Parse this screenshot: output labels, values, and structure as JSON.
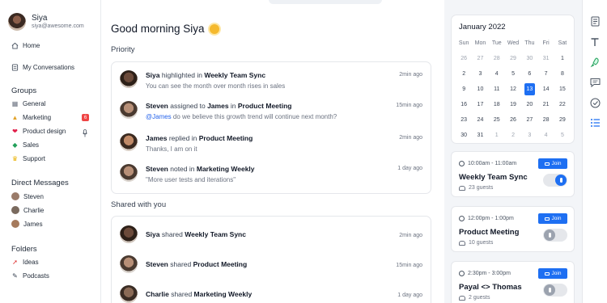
{
  "profile": {
    "name": "Siya",
    "email": "siya@awesome.com"
  },
  "nav": [
    {
      "label": "Home",
      "icon": "home-icon"
    },
    {
      "label": "My Conversations",
      "icon": "conversations-icon"
    }
  ],
  "groups": {
    "heading": "Groups",
    "items": [
      {
        "label": "General",
        "icon": "building-emoji"
      },
      {
        "label": "Marketing",
        "icon": "megaphone-emoji",
        "badge": "6"
      },
      {
        "label": "Product design",
        "icon": "heart-emoji"
      },
      {
        "label": "Sales",
        "icon": "money-emoji"
      },
      {
        "label": "Support",
        "icon": "crown-emoji"
      }
    ]
  },
  "direct_messages": {
    "heading": "Direct Messages",
    "items": [
      {
        "label": "Steven"
      },
      {
        "label": "Charlie"
      },
      {
        "label": "James"
      }
    ]
  },
  "folders": {
    "heading": "Folders",
    "items": [
      {
        "label": "Ideas",
        "icon": "rocket-emoji"
      },
      {
        "label": "Podcasts",
        "icon": "pen-emoji"
      }
    ]
  },
  "main": {
    "greeting": "Good morning Siya",
    "priority_heading": "Priority",
    "priority": [
      {
        "who": "Siya",
        "verb": " highlighted in ",
        "where": "Weekly Team Sync",
        "detail": "You can see the month over month rises in sales",
        "time": "2min ago"
      },
      {
        "who": "Steven",
        "verb": " assigned to ",
        "who2": "James",
        "verb2": " in ",
        "where": "Product Meeting",
        "mention": "@James",
        "detail": " do we believe this growth trend will continue next month?",
        "time": "15min ago"
      },
      {
        "who": "James",
        "verb": " replied in ",
        "where": "Product Meeting",
        "detail": "Thanks, I am on it",
        "time": "2min ago"
      },
      {
        "who": "Steven",
        "verb": " noted in ",
        "where": "Marketing Weekly",
        "detail": "\"More user tests and iterations\"",
        "time": "1 day ago"
      }
    ],
    "shared_heading": "Shared with you",
    "shared": [
      {
        "who": "Siya",
        "verb": " shared ",
        "what": "Weekly Team Sync",
        "time": "2min ago"
      },
      {
        "who": "Steven",
        "verb": " shared ",
        "what": "Product Meeting",
        "time": "15min ago"
      },
      {
        "who": "Charlie",
        "verb": " shared ",
        "what": "Marketing Weekly",
        "time": "1 day ago"
      }
    ]
  },
  "calendar": {
    "title": "January 2022",
    "weekdays": [
      "Sun",
      "Mon",
      "Tue",
      "Wed",
      "Thu",
      "Fri",
      "Sat"
    ],
    "days": [
      [
        "26",
        "27",
        "28",
        "29",
        "30",
        "31",
        "1"
      ],
      [
        "2",
        "3",
        "4",
        "5",
        "6",
        "7",
        "8"
      ],
      [
        "9",
        "10",
        "11",
        "12",
        "13",
        "14",
        "15"
      ],
      [
        "16",
        "17",
        "18",
        "19",
        "20",
        "21",
        "22"
      ],
      [
        "23",
        "24",
        "25",
        "26",
        "27",
        "28",
        "29"
      ],
      [
        "30",
        "31",
        "1",
        "2",
        "3",
        "4",
        "5"
      ]
    ],
    "selected": "13"
  },
  "events": [
    {
      "time": "10:00am - 11:00am",
      "title": "Weekly Team Sync",
      "guests": "23 guests",
      "join": "Join",
      "mic_on": true
    },
    {
      "time": "12:00pm - 1:00pm",
      "title": "Product Meeting",
      "guests": "10 guests",
      "join": "Join",
      "mic_on": false
    },
    {
      "time": "2:30pm - 3:00pm",
      "title": "Payal <> Thomas",
      "guests": "2 guests",
      "join": "Join",
      "mic_on": false
    }
  ],
  "colors": {
    "accent": "#1e6ff2",
    "badge": "#ef4444"
  }
}
